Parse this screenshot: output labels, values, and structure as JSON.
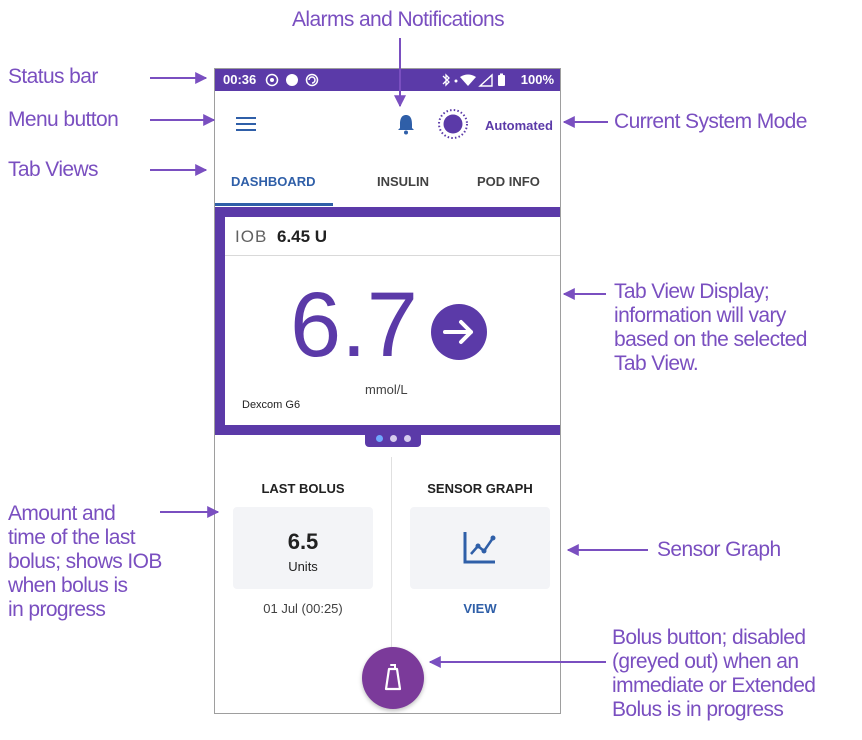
{
  "callouts": {
    "status_bar": "Status bar",
    "menu_button": "Menu button",
    "tab_views": "Tab Views",
    "alarms": "Alarms and Notifications",
    "system_mode": "Current System Mode",
    "tab_view_display": [
      "Tab View Display;",
      "information will vary",
      "based on the selected",
      "Tab View."
    ],
    "last_bolus": [
      "Amount and",
      "time of the last",
      "bolus; shows IOB",
      "when bolus is",
      "in progress"
    ],
    "sensor_graph": "Sensor Graph",
    "bolus_button": [
      "Bolus button; disabled",
      "(greyed out) when an",
      "immediate or Extended",
      "Bolus is in progress"
    ]
  },
  "status_bar": {
    "time": "00:36",
    "battery": "100%"
  },
  "header": {
    "mode": "Automated"
  },
  "tabs": [
    {
      "label": "DASHBOARD",
      "active": true
    },
    {
      "label": "INSULIN",
      "active": false
    },
    {
      "label": "POD INFO",
      "active": false
    }
  ],
  "dashboard": {
    "iob_label": "IOB",
    "iob_value": "6.45 U",
    "glucose": "6.7",
    "unit": "mmol/L",
    "sensor": "Dexcom G6",
    "trend": "arrow-right-icon"
  },
  "last_bolus": {
    "title": "LAST BOLUS",
    "amount": "6.5",
    "unit": "Units",
    "time": "01 Jul (00:25)"
  },
  "sensor_graph": {
    "title": "SENSOR GRAPH",
    "link": "VIEW"
  },
  "colors": {
    "brand_purple": "#5b3aa8",
    "link_blue": "#2f5fa8",
    "callout": "#7a4fc0",
    "fab": "#7b3a9a"
  }
}
